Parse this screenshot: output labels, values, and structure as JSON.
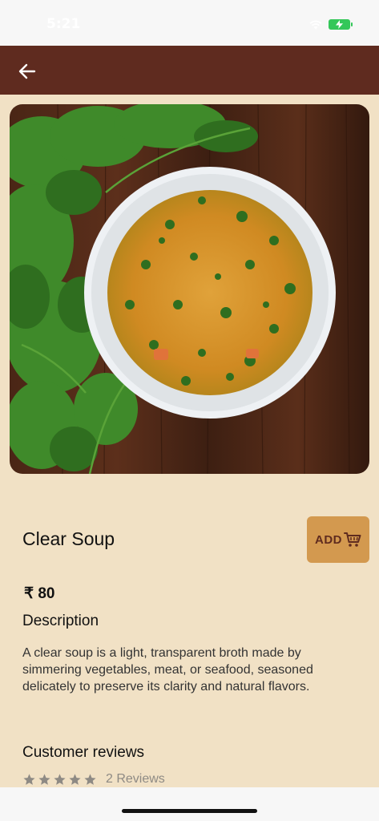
{
  "status_bar": {
    "time": "5:21",
    "battery_color": "#34c759"
  },
  "app_bar": {
    "back_icon": "arrow-left-icon",
    "color": "#5f2b1f"
  },
  "product": {
    "title": "Clear Soup",
    "add_label": "ADD",
    "cart_icon": "cart-icon",
    "price": "₹ 80",
    "description_heading": "Description",
    "description": "A clear soup is a light, transparent broth made by simmering vegetables, meat, or seafood, seasoned delicately to preserve its clarity and natural flavors.",
    "reviews_heading": "Customer reviews",
    "rating": 0,
    "rating_max": 5,
    "reviews_count": "2 Reviews"
  },
  "colors": {
    "background": "#f1e1c5",
    "accent": "#d3994f",
    "brand": "#5f2b1f"
  }
}
